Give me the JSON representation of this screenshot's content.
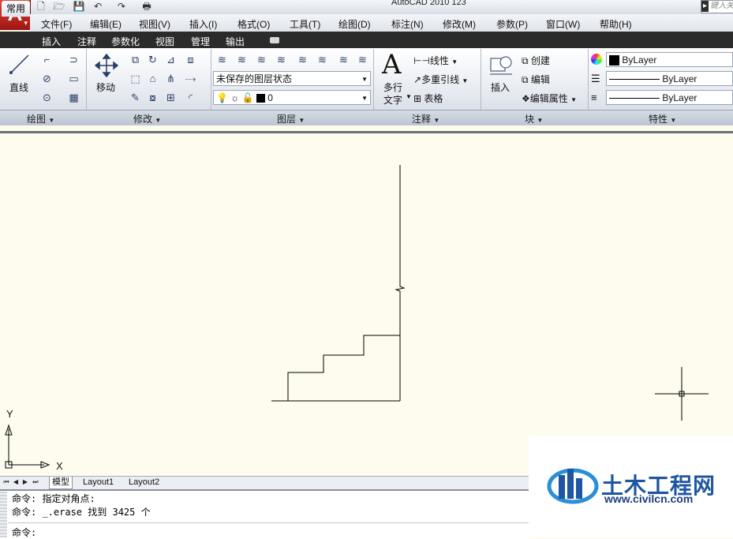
{
  "window": {
    "title": "AutoCAD 2010       123",
    "search_placeholder": "键入关"
  },
  "app_button": {
    "letter": "A"
  },
  "quick_access": [
    "new-icon",
    "open-icon",
    "save-icon",
    "undo-icon",
    "redo-icon",
    "print-icon"
  ],
  "menu": [
    "文件(F)",
    "编辑(E)",
    "视图(V)",
    "插入(I)",
    "格式(O)",
    "工具(T)",
    "绘图(D)",
    "标注(N)",
    "修改(M)",
    "参数(P)",
    "窗口(W)",
    "帮助(H)"
  ],
  "ribbon_tabs": {
    "active": "常用",
    "others": [
      "插入",
      "注释",
      "参数化",
      "视图",
      "管理",
      "输出"
    ]
  },
  "panels": {
    "draw": {
      "title": "绘图",
      "line_label": "直线"
    },
    "modify": {
      "title": "修改",
      "move_label": "移动"
    },
    "layers": {
      "title": "图层",
      "state_value": "未保存的图层状态",
      "current_layer": "0"
    },
    "annotation": {
      "title": "注释",
      "mtext_label_1": "多行",
      "mtext_label_2": "文字",
      "linear_label": "线性",
      "mleader_label": "多重引线",
      "table_label": "表格"
    },
    "block": {
      "title": "块",
      "insert_label": "插入",
      "create_label": "创建",
      "edit_label": "编辑",
      "edit_attr_label": "编辑属性"
    },
    "properties": {
      "title": "特性",
      "color_value": "ByLayer",
      "linetype_value": "ByLayer",
      "lineweight_value": "ByLayer"
    }
  },
  "ucs": {
    "y_label": "Y",
    "x_label": "X"
  },
  "layout_tabs": [
    "模型",
    "Layout1",
    "Layout2"
  ],
  "command_lines": [
    "命令: 指定对角点:",
    "命令: _.erase 找到 3425 个"
  ],
  "command_prompt": "命令:",
  "watermark": {
    "title": "土木工程网",
    "url": "www.civilcn.com"
  },
  "colors": {
    "canvas": "#fdfcef",
    "ribbon_tab_bar": "#2b2b2b",
    "app_red": "#c62b22",
    "watermark_blue": "#1f56a3"
  }
}
